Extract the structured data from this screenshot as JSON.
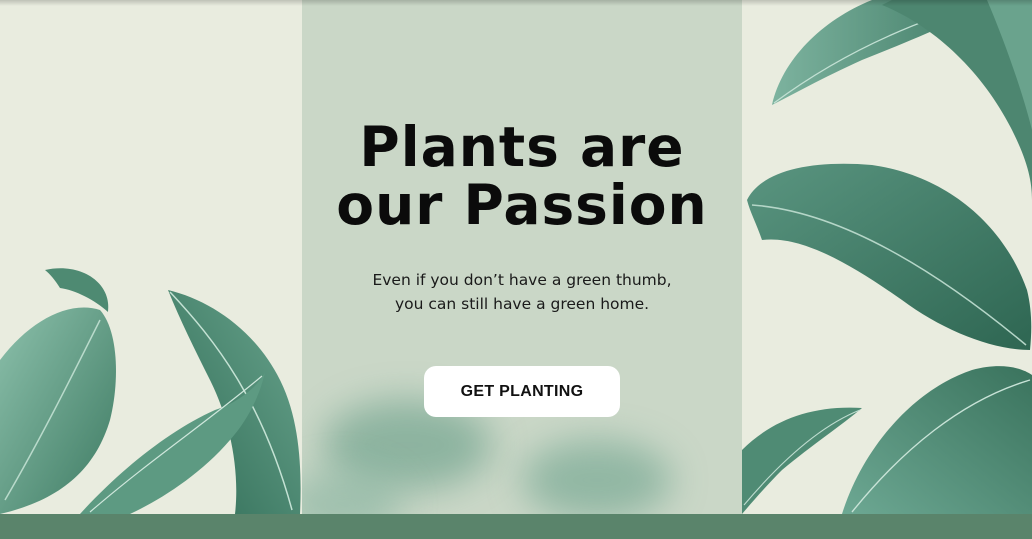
{
  "hero": {
    "headline_line1": "Plants are",
    "headline_line2": "our Passion",
    "subtext_line1": "Even if you don’t have a green thumb,",
    "subtext_line2": "you can still have a green home.",
    "cta_label": "GET PLANTING"
  },
  "colors": {
    "side_background": "#e9ecdf",
    "center_background": "#cad7c7",
    "footer": "#5a846b",
    "leaf_dark": "#3f7a64",
    "leaf_light": "#7fb3a0"
  },
  "decor": {
    "left_leaves_icon": "tropical-leaves",
    "right_leaves_icon": "tropical-leaves"
  }
}
